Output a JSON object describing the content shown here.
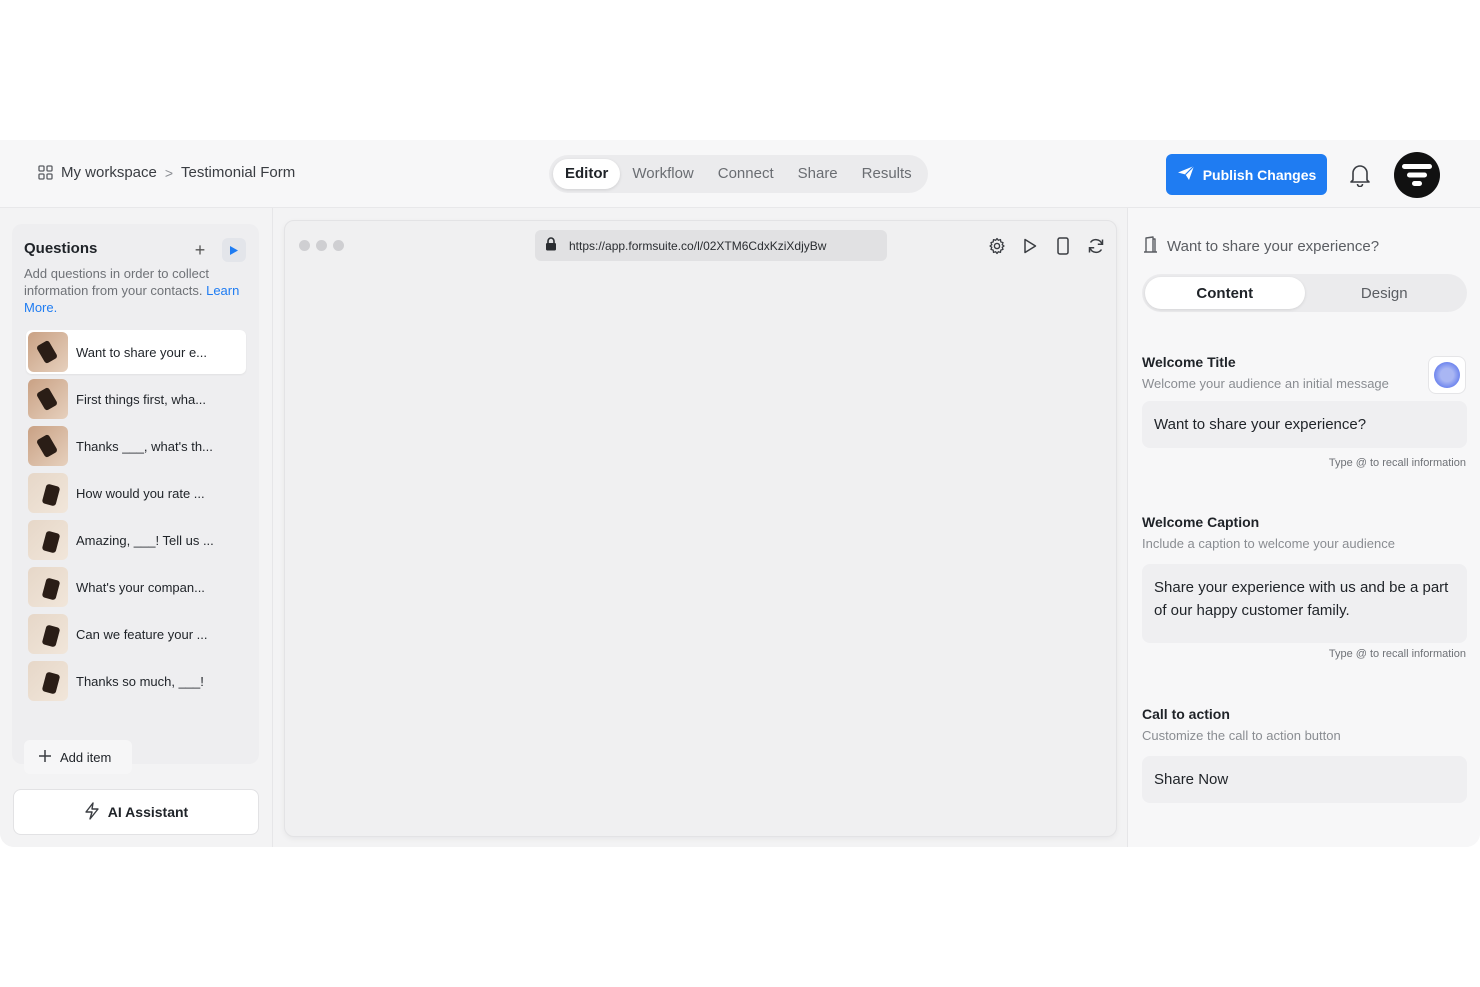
{
  "breadcrumb": {
    "workspace": "My workspace",
    "separator": ">",
    "form": "Testimonial Form"
  },
  "nav": {
    "tabs": [
      {
        "label": "Editor",
        "active": true
      },
      {
        "label": "Workflow"
      },
      {
        "label": "Connect"
      },
      {
        "label": "Share"
      },
      {
        "label": "Results"
      }
    ]
  },
  "header": {
    "publish_label": "Publish Changes",
    "accent": "#1f7cf2"
  },
  "questions": {
    "title": "Questions",
    "description": "Add questions in order to collect information from your contacts.",
    "learn_more": "Learn More.",
    "items": [
      {
        "label": "Want to share your e..."
      },
      {
        "label": "First things first, wha..."
      },
      {
        "label": "Thanks ___, what's th..."
      },
      {
        "label": "How would you rate ..."
      },
      {
        "label": "Amazing, ___! Tell us ..."
      },
      {
        "label": "What's your compan..."
      },
      {
        "label": "Can we feature your ..."
      },
      {
        "label": "Thanks so much, ___!"
      }
    ],
    "add_item": "Add item",
    "ai_assistant": "AI Assistant"
  },
  "browser": {
    "url": "https://app.formsuite.co/l/02XTM6CdxKziXdjyBw"
  },
  "panel": {
    "heading": "Want to share your experience?",
    "tabs": {
      "content": "Content",
      "design": "Design"
    },
    "welcome_title": {
      "label": "Welcome Title",
      "desc": "Welcome your audience an initial message",
      "value": "Want to share your experience?",
      "hint": "Type @ to recall information"
    },
    "welcome_caption": {
      "label": "Welcome Caption",
      "desc": "Include a caption to welcome your audience",
      "value": "Share your experience with us and be a part of our happy customer family.",
      "hint": "Type @ to recall information"
    },
    "cta": {
      "label": "Call to action",
      "desc": "Customize the call to action button",
      "value": "Share Now"
    }
  }
}
